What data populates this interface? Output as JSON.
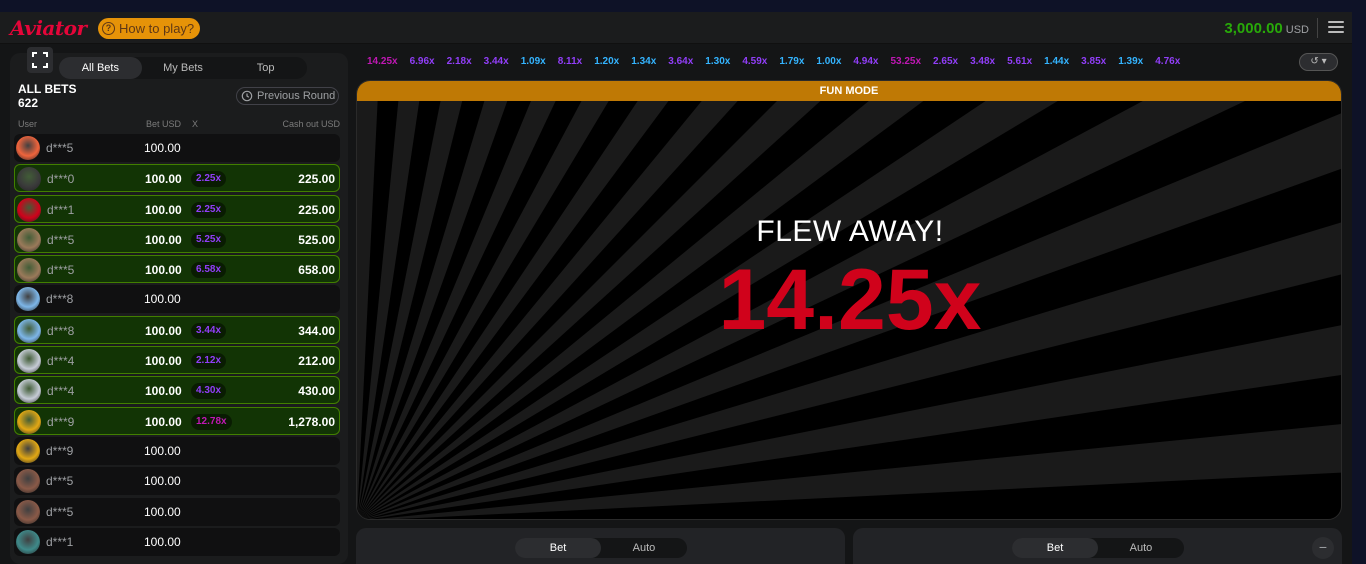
{
  "app": {
    "logo": "Aviator",
    "how_to_play": "How to play?",
    "balance": "3,000.00",
    "currency": "USD"
  },
  "bets_panel": {
    "tabs": [
      "All Bets",
      "My Bets",
      "Top"
    ],
    "active_tab": "All Bets",
    "all_bets_label": "ALL BETS",
    "bet_count": "622",
    "previous_round": "Previous Round",
    "columns": {
      "user": "User",
      "bet": "Bet USD",
      "x": "X",
      "cashout": "Cash out USD"
    },
    "rows": [
      {
        "user": "d***5",
        "bet": "100.00",
        "mult": "",
        "cashout": "",
        "win": false,
        "avatar_color": "#f0643c",
        "mult_color": ""
      },
      {
        "user": "d***0",
        "bet": "100.00",
        "mult": "2.25x",
        "cashout": "225.00",
        "win": true,
        "avatar_color": "#3a3a3a",
        "mult_color": "#913ef8"
      },
      {
        "user": "d***1",
        "bet": "100.00",
        "mult": "2.25x",
        "cashout": "225.00",
        "win": true,
        "avatar_color": "#d0021b",
        "mult_color": "#913ef8"
      },
      {
        "user": "d***5",
        "bet": "100.00",
        "mult": "5.25x",
        "cashout": "525.00",
        "win": true,
        "avatar_color": "#9a7a5a",
        "mult_color": "#913ef8"
      },
      {
        "user": "d***5",
        "bet": "100.00",
        "mult": "6.58x",
        "cashout": "658.00",
        "win": true,
        "avatar_color": "#9a7a5a",
        "mult_color": "#913ef8"
      },
      {
        "user": "d***8",
        "bet": "100.00",
        "mult": "",
        "cashout": "",
        "win": false,
        "avatar_color": "#7db6e8",
        "mult_color": ""
      },
      {
        "user": "d***8",
        "bet": "100.00",
        "mult": "3.44x",
        "cashout": "344.00",
        "win": true,
        "avatar_color": "#7db6e8",
        "mult_color": "#913ef8"
      },
      {
        "user": "d***4",
        "bet": "100.00",
        "mult": "2.12x",
        "cashout": "212.00",
        "win": true,
        "avatar_color": "#c6ccd6",
        "mult_color": "#913ef8"
      },
      {
        "user": "d***4",
        "bet": "100.00",
        "mult": "4.30x",
        "cashout": "430.00",
        "win": true,
        "avatar_color": "#c6ccd6",
        "mult_color": "#913ef8"
      },
      {
        "user": "d***9",
        "bet": "100.00",
        "mult": "12.78x",
        "cashout": "1,278.00",
        "win": true,
        "avatar_color": "#e2a814",
        "mult_color": "#c017b4"
      },
      {
        "user": "d***9",
        "bet": "100.00",
        "mult": "",
        "cashout": "",
        "win": false,
        "avatar_color": "#e2a814",
        "mult_color": ""
      },
      {
        "user": "d***5",
        "bet": "100.00",
        "mult": "",
        "cashout": "",
        "win": false,
        "avatar_color": "#8a5a48",
        "mult_color": ""
      },
      {
        "user": "d***5",
        "bet": "100.00",
        "mult": "",
        "cashout": "",
        "win": false,
        "avatar_color": "#8a5a48",
        "mult_color": ""
      },
      {
        "user": "d***1",
        "bet": "100.00",
        "mult": "",
        "cashout": "",
        "win": false,
        "avatar_color": "#3f8a8a",
        "mult_color": ""
      }
    ]
  },
  "history": [
    {
      "v": "14.25x",
      "c": "#c017b4"
    },
    {
      "v": "6.96x",
      "c": "#913ef8"
    },
    {
      "v": "2.18x",
      "c": "#913ef8"
    },
    {
      "v": "3.44x",
      "c": "#913ef8"
    },
    {
      "v": "1.09x",
      "c": "#34b4ff"
    },
    {
      "v": "8.11x",
      "c": "#913ef8"
    },
    {
      "v": "1.20x",
      "c": "#34b4ff"
    },
    {
      "v": "1.34x",
      "c": "#34b4ff"
    },
    {
      "v": "3.64x",
      "c": "#913ef8"
    },
    {
      "v": "1.30x",
      "c": "#34b4ff"
    },
    {
      "v": "4.59x",
      "c": "#913ef8"
    },
    {
      "v": "1.79x",
      "c": "#34b4ff"
    },
    {
      "v": "1.00x",
      "c": "#34b4ff"
    },
    {
      "v": "4.94x",
      "c": "#913ef8"
    },
    {
      "v": "53.25x",
      "c": "#c017b4"
    },
    {
      "v": "2.65x",
      "c": "#913ef8"
    },
    {
      "v": "3.48x",
      "c": "#913ef8"
    },
    {
      "v": "5.61x",
      "c": "#913ef8"
    },
    {
      "v": "1.44x",
      "c": "#34b4ff"
    },
    {
      "v": "3.85x",
      "c": "#913ef8"
    },
    {
      "v": "1.39x",
      "c": "#34b4ff"
    },
    {
      "v": "4.76x",
      "c": "#913ef8"
    }
  ],
  "game": {
    "fun_mode": "FUN MODE",
    "flew_away": "FLEW AWAY!",
    "multiplier": "14.25x"
  },
  "bet_controls": [
    {
      "tabs": [
        "Bet",
        "Auto"
      ],
      "active": "Bet"
    },
    {
      "tabs": [
        "Bet",
        "Auto"
      ],
      "active": "Bet"
    }
  ],
  "colors": {
    "accent_red": "#d0021b",
    "balance_green": "#28a909",
    "fun_mode_bar": "#bf7905"
  }
}
